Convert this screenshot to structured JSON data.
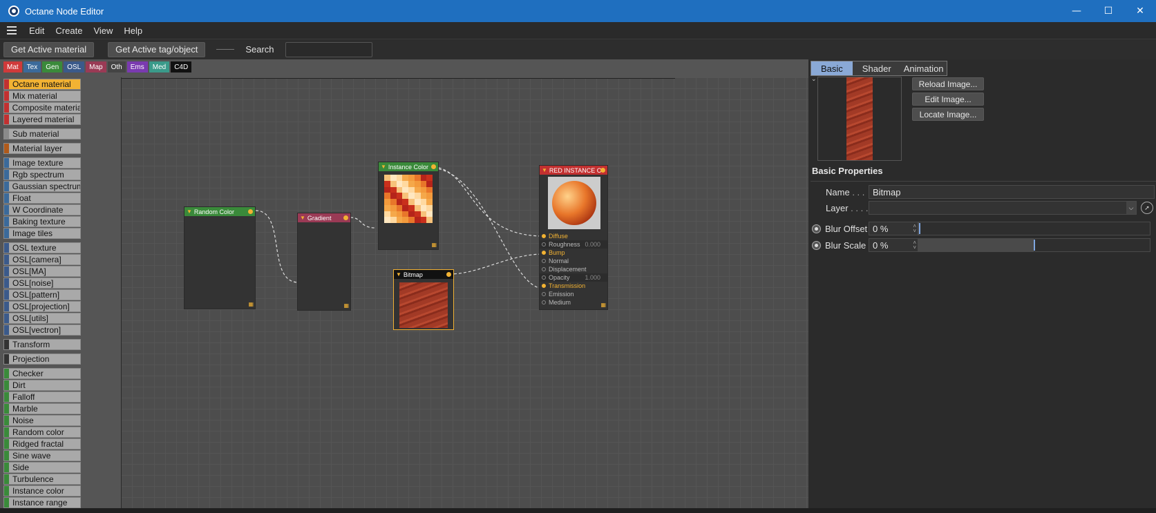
{
  "window": {
    "title": "Octane Node Editor",
    "controls": [
      "minimize-icon",
      "maximize-icon",
      "close-icon"
    ]
  },
  "menu": {
    "items": [
      "Edit",
      "Create",
      "View",
      "Help"
    ]
  },
  "toolbar": {
    "get_active_material": "Get Active material",
    "get_active_tag": "Get Active tag/object",
    "search_label": "Search",
    "search_value": ""
  },
  "categories": [
    {
      "label": "Mat",
      "color": "#d03a3a"
    },
    {
      "label": "Tex",
      "color": "#3b6a9a"
    },
    {
      "label": "Gen",
      "color": "#3a8a3a"
    },
    {
      "label": "OSL",
      "color": "#3b5a8a"
    },
    {
      "label": "Map",
      "color": "#9a3a55"
    },
    {
      "label": "Oth",
      "color": "#444444"
    },
    {
      "label": "Ems",
      "color": "#7a3ab0"
    },
    {
      "label": "Med",
      "color": "#3a9a8a"
    },
    {
      "label": "C4D",
      "color": "#111111"
    }
  ],
  "node_list": [
    {
      "label": "Octane material",
      "color": "#c23030",
      "active": true
    },
    {
      "label": "Mix material",
      "color": "#c23030"
    },
    {
      "label": "Composite material",
      "color": "#c23030"
    },
    {
      "label": "Layered material",
      "color": "#c23030",
      "gap": true
    },
    {
      "label": "Sub material",
      "color": "#8a8a8a",
      "gap": true
    },
    {
      "label": "Material layer",
      "color": "#b05a1a",
      "gap": true
    },
    {
      "label": "Image texture",
      "color": "#3b6a9a"
    },
    {
      "label": "Rgb spectrum",
      "color": "#3b6a9a"
    },
    {
      "label": "Gaussian spectrum",
      "color": "#3b6a9a"
    },
    {
      "label": "Float",
      "color": "#3b6a9a"
    },
    {
      "label": "W Coordinate",
      "color": "#3b6a9a"
    },
    {
      "label": "Baking texture",
      "color": "#3b6a9a"
    },
    {
      "label": "Image tiles",
      "color": "#3b6a9a",
      "gap": true
    },
    {
      "label": "OSL texture",
      "color": "#3b5a8a"
    },
    {
      "label": "OSL[camera]",
      "color": "#3b5a8a"
    },
    {
      "label": "OSL[MA]",
      "color": "#3b5a8a"
    },
    {
      "label": "OSL[noise]",
      "color": "#3b5a8a"
    },
    {
      "label": "OSL[pattern]",
      "color": "#3b5a8a"
    },
    {
      "label": "OSL[projection]",
      "color": "#3b5a8a"
    },
    {
      "label": "OSL[utils]",
      "color": "#3b5a8a"
    },
    {
      "label": "OSL[vectron]",
      "color": "#3b5a8a",
      "gap": true
    },
    {
      "label": "Transform",
      "color": "#333333",
      "gap": true
    },
    {
      "label": "Projection",
      "color": "#333333",
      "gap": true
    },
    {
      "label": "Checker",
      "color": "#3a8a3a"
    },
    {
      "label": "Dirt",
      "color": "#3a8a3a"
    },
    {
      "label": "Falloff",
      "color": "#3a8a3a"
    },
    {
      "label": "Marble",
      "color": "#3a8a3a"
    },
    {
      "label": "Noise",
      "color": "#3a8a3a"
    },
    {
      "label": "Random color",
      "color": "#3a8a3a"
    },
    {
      "label": "Ridged fractal",
      "color": "#3a8a3a"
    },
    {
      "label": "Sine wave",
      "color": "#3a8a3a"
    },
    {
      "label": "Side",
      "color": "#3a8a3a"
    },
    {
      "label": "Turbulence",
      "color": "#3a8a3a"
    },
    {
      "label": "Instance color",
      "color": "#3a8a3a"
    },
    {
      "label": "Instance range",
      "color": "#3a8a3a"
    }
  ],
  "graph": {
    "random_color": {
      "title": "Random Color",
      "color": "#3a8a3a"
    },
    "gradient": {
      "title": "Gradient",
      "color": "#9a3a55"
    },
    "instance_color": {
      "title": "Instance Color",
      "color": "#3a8a3a"
    },
    "bitmap": {
      "title": "Bitmap",
      "color": "#111111"
    },
    "material": {
      "title": "RED INSTANCE C",
      "color": "#c23030",
      "ports": [
        {
          "label": "Diffuse",
          "on": true
        },
        {
          "label": "Roughness",
          "value": "0.000",
          "dark": true
        },
        {
          "label": "Bump",
          "on": true
        },
        {
          "label": "Normal"
        },
        {
          "label": "Displacement"
        },
        {
          "label": "Opacity",
          "value": "1.000",
          "dark": true
        },
        {
          "label": "Transmission",
          "on": true
        },
        {
          "label": "Emission"
        },
        {
          "label": "Medium"
        }
      ]
    }
  },
  "properties": {
    "tabs": [
      "Basic",
      "Shader",
      "Animation"
    ],
    "active_tab": "Basic",
    "buttons": {
      "reload": "Reload Image...",
      "edit": "Edit Image...",
      "locate": "Locate Image..."
    },
    "section_title": "Basic Properties",
    "name_label": "Name",
    "name_dots": ". . .",
    "name_value": "Bitmap",
    "layer_label": "Layer",
    "layer_dots": ". . . .",
    "layer_value": "",
    "blur_offset_label": "Blur Offset",
    "blur_offset_value": "0 %",
    "blur_offset_level": 0,
    "blur_scale_label": "Blur Scale",
    "blur_scale_value": "0 %",
    "blur_scale_level": 0.5
  }
}
